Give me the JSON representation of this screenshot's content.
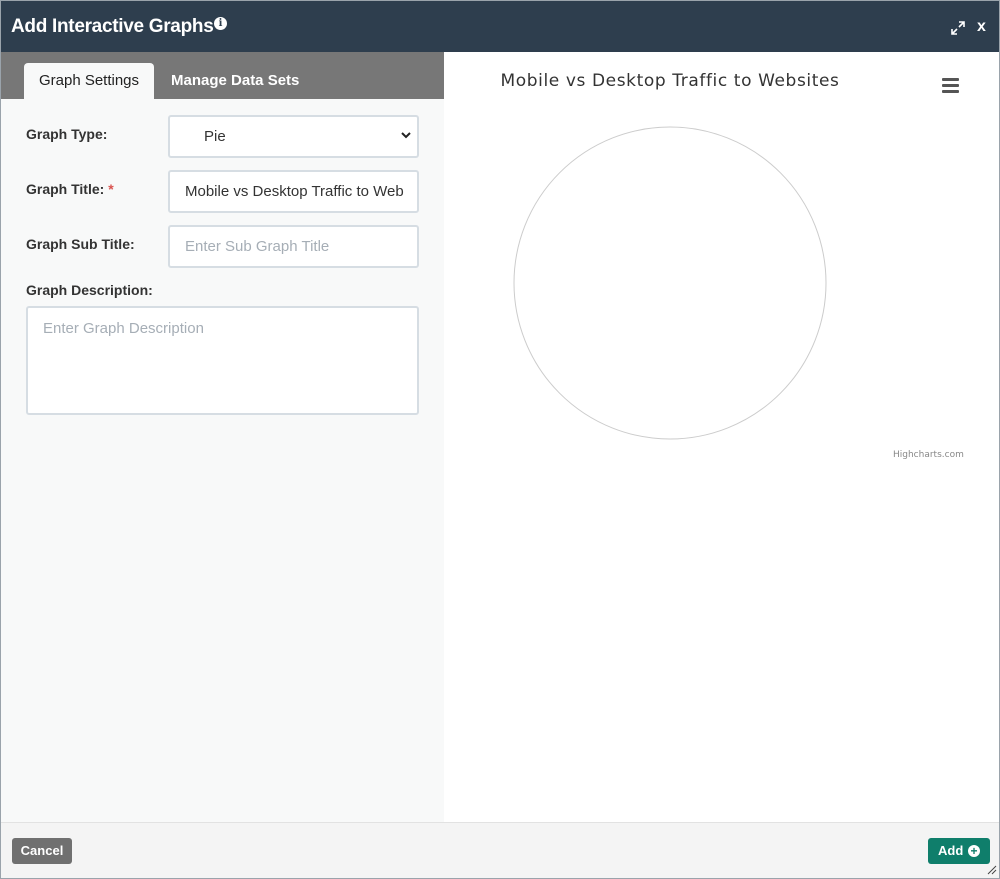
{
  "dialog": {
    "title": "Add Interactive Graphs",
    "info_icon": "i",
    "close_label": "x"
  },
  "tabs": {
    "settings": "Graph Settings",
    "datasets": "Manage Data Sets"
  },
  "form": {
    "graph_type_label": "Graph Type:",
    "graph_type_value": "Pie",
    "graph_title_label": "Graph Title:",
    "required_mark": "*",
    "graph_title_value": "Mobile vs Desktop Traffic to Web",
    "graph_subtitle_label": "Graph Sub Title:",
    "graph_subtitle_placeholder": "Enter Sub Graph Title",
    "graph_description_label": "Graph Description:",
    "graph_description_placeholder": "Enter Graph Description"
  },
  "chart_data": {
    "type": "pie",
    "title": "Mobile vs Desktop Traffic to Websites",
    "series": [],
    "credits": "Highcharts.com",
    "colors": {
      "outline": "#cccccc"
    }
  },
  "footer": {
    "cancel_label": "Cancel",
    "add_label": "Add"
  },
  "icons": {
    "expand": "expand-icon",
    "menu": "hamburger-menu-icon",
    "add": "plus-circle-icon",
    "chevron": "chevron-down-icon"
  }
}
